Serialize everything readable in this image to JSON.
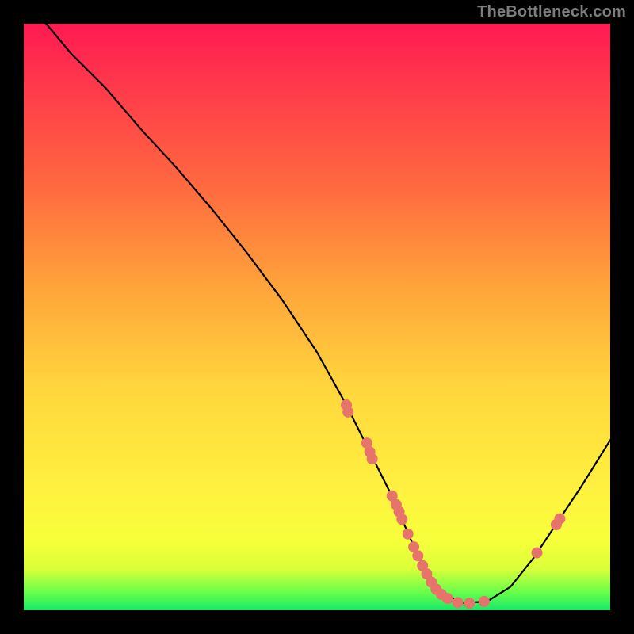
{
  "watermark": "TheBottleneck.com",
  "chart_data": {
    "type": "line",
    "title": "",
    "xlabel": "",
    "ylabel": "",
    "xlim": [
      0,
      100
    ],
    "ylim": [
      0,
      100
    ],
    "grid": false,
    "legend": false,
    "series": [
      {
        "name": "curve",
        "x": [
          0,
          3,
          8,
          14,
          20,
          26,
          32,
          38,
          44,
          50,
          55,
          59,
          63,
          66,
          68.5,
          71,
          74.5,
          79,
          83,
          87,
          91,
          95,
          100
        ],
        "y": [
          107,
          101,
          95,
          89,
          82,
          75.5,
          68.5,
          61,
          53,
          44,
          35,
          27,
          19,
          12,
          7,
          3.5,
          1.2,
          1.5,
          4,
          9,
          15,
          21,
          29
        ]
      }
    ],
    "scatter": {
      "name": "dots",
      "color": "#e7746a",
      "radius": 7,
      "points": [
        {
          "x": 55.0,
          "y": 35.0
        },
        {
          "x": 55.3,
          "y": 33.8
        },
        {
          "x": 58.5,
          "y": 28.5
        },
        {
          "x": 59.0,
          "y": 27.0
        },
        {
          "x": 59.4,
          "y": 25.8
        },
        {
          "x": 62.8,
          "y": 19.5
        },
        {
          "x": 63.5,
          "y": 18.0
        },
        {
          "x": 64.0,
          "y": 16.8
        },
        {
          "x": 64.5,
          "y": 15.5
        },
        {
          "x": 65.5,
          "y": 13.0
        },
        {
          "x": 66.5,
          "y": 10.8
        },
        {
          "x": 67.2,
          "y": 9.3
        },
        {
          "x": 68.0,
          "y": 7.6
        },
        {
          "x": 68.7,
          "y": 6.2
        },
        {
          "x": 69.5,
          "y": 4.8
        },
        {
          "x": 70.3,
          "y": 3.6
        },
        {
          "x": 71.2,
          "y": 2.7
        },
        {
          "x": 72.3,
          "y": 2.0
        },
        {
          "x": 74.0,
          "y": 1.3
        },
        {
          "x": 76.0,
          "y": 1.2
        },
        {
          "x": 78.5,
          "y": 1.5
        },
        {
          "x": 87.5,
          "y": 9.8
        },
        {
          "x": 90.8,
          "y": 14.6
        },
        {
          "x": 91.4,
          "y": 15.6
        }
      ]
    }
  }
}
